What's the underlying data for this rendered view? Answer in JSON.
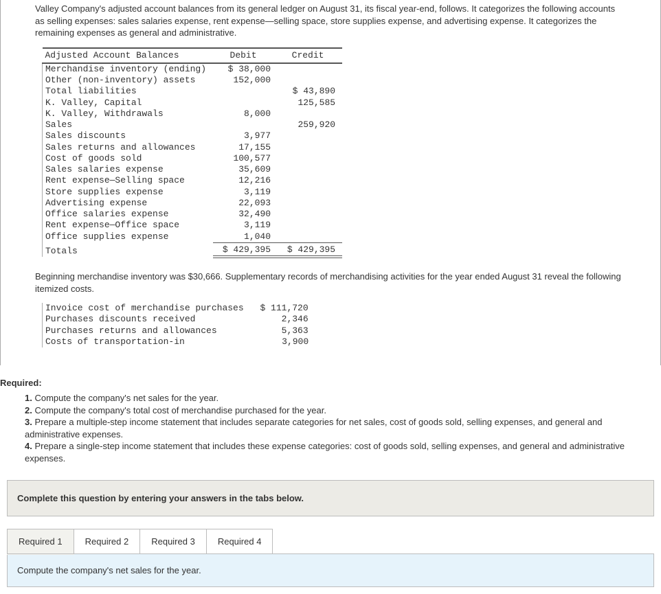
{
  "intro": "Valley Company's adjusted account balances from its general ledger on August 31, its fiscal year-end, follows. It categorizes the following accounts as selling expenses: sales salaries expense, rent expense—selling space, store supplies expense, and advertising expense. It categorizes the remaining expenses as general and administrative.",
  "table1": {
    "title": "Adjusted Account Balances",
    "col_debit": "Debit",
    "col_credit": "Credit",
    "rows": [
      {
        "label": "Merchandise inventory (ending)",
        "debit": "$ 38,000",
        "credit": ""
      },
      {
        "label": "Other (non-inventory) assets",
        "debit": "152,000",
        "credit": ""
      },
      {
        "label": "Total liabilities",
        "debit": "",
        "credit": "$ 43,890"
      },
      {
        "label": "K. Valley, Capital",
        "debit": "",
        "credit": "125,585"
      },
      {
        "label": "K. Valley, Withdrawals",
        "debit": "8,000",
        "credit": ""
      },
      {
        "label": "Sales",
        "debit": "",
        "credit": "259,920"
      },
      {
        "label": "Sales discounts",
        "debit": "3,977",
        "credit": ""
      },
      {
        "label": "Sales returns and allowances",
        "debit": "17,155",
        "credit": ""
      },
      {
        "label": "Cost of goods sold",
        "debit": "100,577",
        "credit": ""
      },
      {
        "label": "Sales salaries expense",
        "debit": "35,609",
        "credit": ""
      },
      {
        "label": "Rent expense—Selling space",
        "debit": "12,216",
        "credit": ""
      },
      {
        "label": "Store supplies expense",
        "debit": "3,119",
        "credit": ""
      },
      {
        "label": "Advertising expense",
        "debit": "22,093",
        "credit": ""
      },
      {
        "label": "Office salaries expense",
        "debit": "32,490",
        "credit": ""
      },
      {
        "label": "Rent expense—Office space",
        "debit": "3,119",
        "credit": ""
      },
      {
        "label": "Office supplies expense",
        "debit": "1,040",
        "credit": ""
      }
    ],
    "total_label": "Totals",
    "total_debit": "$ 429,395",
    "total_credit": "$ 429,395"
  },
  "middle_text": "Beginning merchandise inventory was $30,666. Supplementary records of merchandising activities for the year ended August 31 reveal the following itemized costs.",
  "table2": {
    "rows": [
      {
        "label": "Invoice cost of merchandise purchases",
        "value": "$ 111,720"
      },
      {
        "label": "Purchases discounts received",
        "value": "2,346"
      },
      {
        "label": "Purchases returns and allowances",
        "value": "5,363"
      },
      {
        "label": "Costs of transportation-in",
        "value": "3,900"
      }
    ]
  },
  "required_label": "Required:",
  "reqs": {
    "r1b": "1.",
    "r1": " Compute the company's net sales for the year.",
    "r2b": "2.",
    "r2": " Compute the company's total cost of merchandise purchased for the year.",
    "r3b": "3.",
    "r3": " Prepare a multiple-step income statement that includes separate categories for net sales, cost of goods sold, selling expenses, and general and administrative expenses.",
    "r4b": "4.",
    "r4": " Prepare a single-step income statement that includes these expense categories: cost of goods sold, selling expenses, and general and administrative expenses."
  },
  "instruction": "Complete this question by entering your answers in the tabs below.",
  "tabs": {
    "t1": "Required 1",
    "t2": "Required 2",
    "t3": "Required 3",
    "t4": "Required 4"
  },
  "sub_instruction": "Compute the company's net sales for the year."
}
